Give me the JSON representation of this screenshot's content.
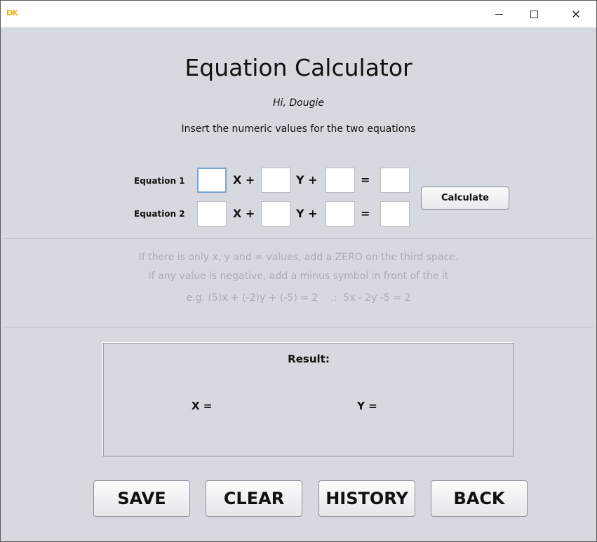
{
  "window": {
    "app_icon_text": "DK",
    "controls": {
      "minimize": "minimize",
      "maximize": "maximize",
      "close": "✕"
    }
  },
  "header": {
    "title": "Equation Calculator",
    "greeting": "Hi, Dougie",
    "instruction": "Insert the numeric values for the two equations"
  },
  "equations": [
    {
      "label": "Equation 1",
      "x_coef": "",
      "y_coef": "",
      "constant": "",
      "result": ""
    },
    {
      "label": "Equation 2",
      "x_coef": "",
      "y_coef": "",
      "constant": "",
      "result": ""
    }
  ],
  "operators": {
    "x_plus": "X +",
    "y_plus": "Y +",
    "equals": "="
  },
  "calculate_label": "Calculate",
  "hints": [
    "If there is only x, y and = values, add a ZERO on the third space.",
    "If any value is negative, add a minus symbol in front of the it",
    "e.g. (5)x + (-2)y + (-5) = 2    .:  5x - 2y -5 = 2"
  ],
  "result": {
    "title": "Result:",
    "x_label": "X =",
    "y_label": "Y ="
  },
  "buttons": {
    "save": "SAVE",
    "clear": "CLEAR",
    "history": "HISTORY",
    "back": "BACK"
  },
  "colors": {
    "background": "#d6d9df",
    "hint_text": "#a9acb3",
    "focus_border": "#7ea4d4",
    "icon_accent": "#e8b01c"
  }
}
